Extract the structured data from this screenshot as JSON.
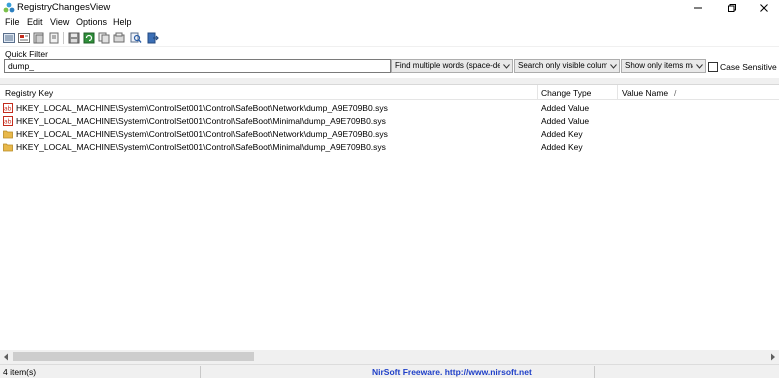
{
  "window": {
    "title": "RegistryChangesView",
    "icon": "registry-app-icon",
    "controls": [
      "minimize-icon",
      "maximize-icon",
      "close-icon"
    ]
  },
  "menu": {
    "file": "File",
    "edit": "Edit",
    "view": "View",
    "options": "Options",
    "help": "Help"
  },
  "toolbar": {
    "icons": [
      "html-report-icon",
      "text-report-icon",
      "export-icon",
      "properties-icon",
      "save-icon",
      "refresh-icon",
      "copy-icon",
      "report-icon",
      "find-icon",
      "exit-icon"
    ]
  },
  "filter": {
    "label": "Quick Filter",
    "value": "dump_",
    "mode": "Find multiple words (space-delimited)",
    "scope": "Search only visible columns",
    "show": "Show only items matching",
    "case_label": "Case Sensitive",
    "case_checked": false
  },
  "columns": {
    "key": "Registry Key",
    "change": "Change Type",
    "value_name": "Value Name",
    "sort_indicator": "/"
  },
  "rows": [
    {
      "icon": "string-value-icon",
      "key": "HKEY_LOCAL_MACHINE\\System\\ControlSet001\\Control\\SafeBoot\\Network\\dump_A9E709B0.sys",
      "change": "Added Value",
      "value_name": ""
    },
    {
      "icon": "string-value-icon",
      "key": "HKEY_LOCAL_MACHINE\\System\\ControlSet001\\Control\\SafeBoot\\Minimal\\dump_A9E709B0.sys",
      "change": "Added Value",
      "value_name": ""
    },
    {
      "icon": "folder-icon",
      "key": "HKEY_LOCAL_MACHINE\\System\\ControlSet001\\Control\\SafeBoot\\Network\\dump_A9E709B0.sys",
      "change": "Added Key",
      "value_name": ""
    },
    {
      "icon": "folder-icon",
      "key": "HKEY_LOCAL_MACHINE\\System\\ControlSet001\\Control\\SafeBoot\\Minimal\\dump_A9E709B0.sys",
      "change": "Added Key",
      "value_name": ""
    }
  ],
  "status": {
    "count": "4 item(s)",
    "credit": "NirSoft Freeware.  http://www.nirsoft.net"
  },
  "colors": {
    "credit": "#1e3fc8",
    "string_icon_red": "#c42b1c",
    "folder_yellow": "#e8b84a"
  }
}
